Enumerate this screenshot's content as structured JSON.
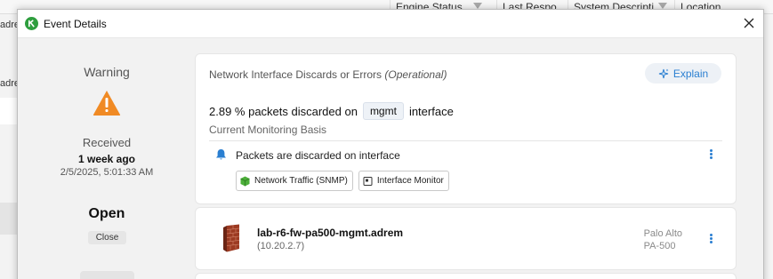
{
  "background": {
    "columns": [
      "Engine Status",
      "Last Respo...",
      "System Descripti...",
      "Location"
    ],
    "row_labels": [
      "adre",
      "adre"
    ]
  },
  "dialog": {
    "title": "Event Details"
  },
  "summary": {
    "severity": "Warning",
    "received_label": "Received",
    "received_relative": "1 week ago",
    "received_absolute": "2/5/2025, 5:01:33 AM",
    "state": "Open",
    "close_button": "Close"
  },
  "event": {
    "type": "Network Interface Discards or Errors",
    "type_status": "(Operational)",
    "explain_button": "Explain",
    "metric_value": "2.89 % packets discarded on",
    "interface": "mgmt",
    "metric_suffix": "interface",
    "basis": "Current Monitoring Basis",
    "message": "Packets are discarded on interface",
    "tags": [
      {
        "label": "Network Traffic (SNMP)",
        "icon": "cube-icon"
      },
      {
        "label": "Interface Monitor",
        "icon": "monitor-icon"
      }
    ]
  },
  "device": {
    "name": "lab-r6-fw-pa500-mgmt.adrem",
    "ip": "(10.20.2.7)",
    "vendor": "Palo Alto",
    "model": "PA-500",
    "icon": "firewall-icon"
  },
  "colors": {
    "warning": "#f08a24",
    "accent": "#2a7fd1",
    "app_icon": "#2e9e3e"
  }
}
